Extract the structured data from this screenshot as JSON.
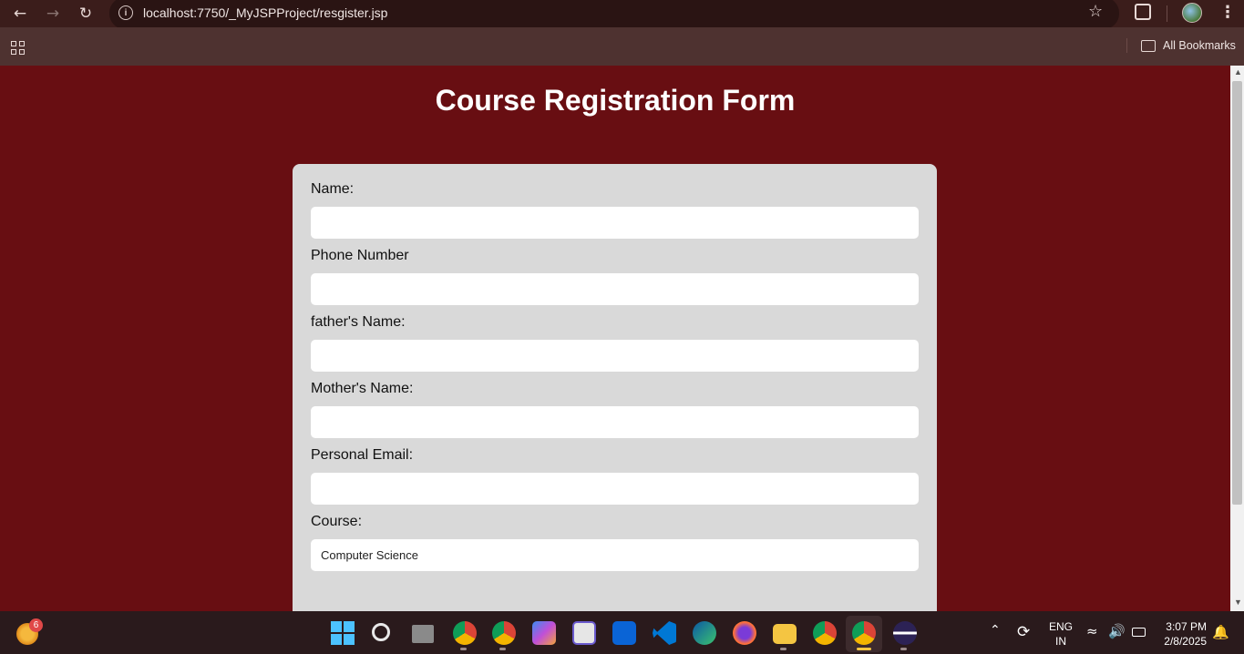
{
  "browser": {
    "url": "localhost:7750/_MyJSPProject/resgister.jsp",
    "bookmarks_label": "All Bookmarks"
  },
  "page": {
    "title": "Course Registration Form",
    "fields": [
      {
        "label": "Name:",
        "value": ""
      },
      {
        "label": "Phone Number",
        "value": ""
      },
      {
        "label": "father's Name:",
        "value": ""
      },
      {
        "label": "Mother's Name:",
        "value": ""
      },
      {
        "label": "Personal Email:",
        "value": ""
      },
      {
        "label": "Course:",
        "value": "Computer Science"
      }
    ]
  },
  "taskbar": {
    "weather_badge": "6",
    "lang_top": "ENG",
    "lang_bottom": "IN",
    "time": "3:07 PM",
    "date": "2/8/2025",
    "icons": [
      "windows-start-icon",
      "search-icon",
      "task-view-icon",
      "chrome-icon",
      "chrome-profile-icon",
      "copilot-icon",
      "clipchamp-icon",
      "outlook-icon",
      "vscode-icon",
      "edge-icon",
      "firefox-icon",
      "file-explorer-icon",
      "chrome-icon",
      "chrome-active-icon",
      "eclipse-icon"
    ]
  },
  "colors": {
    "page_bg": "#680e12",
    "card_bg": "#d9d9d9",
    "chrome_bar": "#3b1d1b"
  }
}
